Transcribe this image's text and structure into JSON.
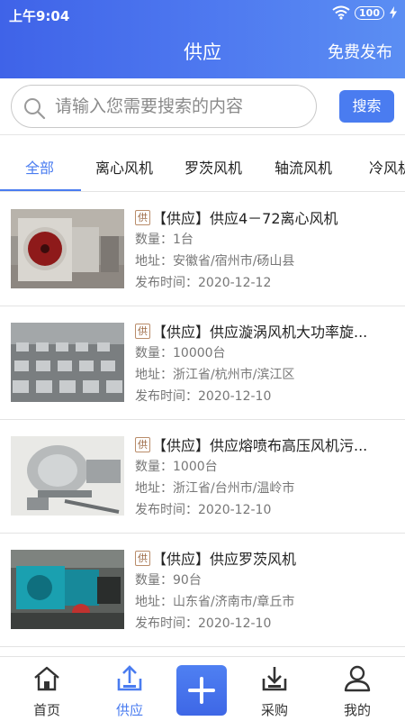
{
  "status": {
    "time": "上午9:04",
    "battery": "100"
  },
  "header": {
    "title": "供应",
    "publish": "免费发布"
  },
  "search": {
    "placeholder": "请输入您需要搜索的内容",
    "button": "搜索"
  },
  "tabs": [
    "全部",
    "离心风机",
    "罗茨风机",
    "轴流风机",
    "冷风机"
  ],
  "list": [
    {
      "badge": "供",
      "title": "【供应】供应4－72离心风机",
      "qty": "数量：1台",
      "addr": "地址：安徽省/宿州市/砀山县",
      "date": "发布时间：2020-12-12"
    },
    {
      "badge": "供",
      "title": "【供应】供应漩涡风机大功率旋...",
      "qty": "数量：10000台",
      "addr": "地址：浙江省/杭州市/滨江区",
      "date": "发布时间：2020-12-10"
    },
    {
      "badge": "供",
      "title": "【供应】供应熔喷布高压风机污...",
      "qty": "数量：1000台",
      "addr": "地址：浙江省/台州市/温岭市",
      "date": "发布时间：2020-12-10"
    },
    {
      "badge": "供",
      "title": "【供应】供应罗茨风机",
      "qty": "数量：90台",
      "addr": "地址：山东省/济南市/章丘市",
      "date": "发布时间：2020-12-10"
    }
  ],
  "nav": {
    "home": "首页",
    "supply": "供应",
    "purchase": "采购",
    "mine": "我的"
  },
  "colors": {
    "accent": "#4a7cf0",
    "header_start": "#3f63e8",
    "header_end": "#5b8ef3"
  },
  "icons": {
    "search": "search-icon",
    "home": "home-icon",
    "supply": "upload-tray-icon",
    "add": "plus-icon",
    "purchase": "download-tray-icon",
    "mine": "user-icon"
  }
}
